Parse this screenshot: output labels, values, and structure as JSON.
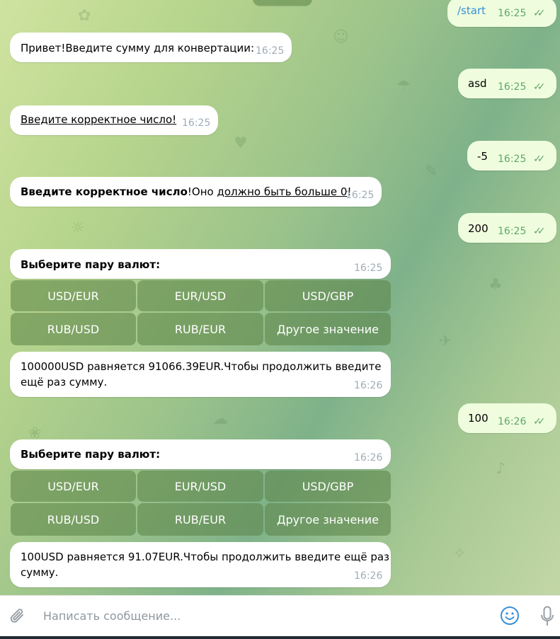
{
  "messages": [
    {
      "kind": "out",
      "text": "/start",
      "time": "16:25"
    },
    {
      "kind": "in",
      "text": "Привет!Введите сумму для конвертации:",
      "time": "16:25"
    },
    {
      "kind": "out",
      "text": "asd",
      "time": "16:25"
    },
    {
      "kind": "in",
      "text": "Введите корректное число!",
      "time": "16:25"
    },
    {
      "kind": "out",
      "text": "-5",
      "time": "16:25"
    },
    {
      "kind": "in",
      "bold": "Введите корректное число",
      "mid": "!Оно ",
      "link": "должно быть больше 0",
      "tail": "!",
      "time": "16:25"
    },
    {
      "kind": "out",
      "text": "200",
      "time": "16:25"
    },
    {
      "kind": "in",
      "text": "Выберите пару валют:",
      "time": "16:25"
    },
    {
      "kind": "in",
      "line1": "100000USD равняется 91066.39EUR.Чтобы продолжить введите",
      "line2": "ещё раз сумму.",
      "time": "16:26"
    },
    {
      "kind": "out",
      "text": "100",
      "time": "16:26"
    },
    {
      "kind": "in",
      "text": "Выберите пару валют:",
      "time": "16:26"
    },
    {
      "kind": "in",
      "line1": "100USD равняется 91.07EUR.Чтобы продолжить введите ещё раз",
      "line2": "сумму.",
      "time": "16:26"
    }
  ],
  "keyboard1": [
    "USD/EUR",
    "EUR/USD",
    "USD/GBP",
    "RUB/USD",
    "RUB/EUR",
    "Другое значение"
  ],
  "keyboard2": [
    "USD/EUR",
    "EUR/USD",
    "USD/GBP",
    "RUB/USD",
    "RUB/EUR",
    "Другое значение"
  ],
  "composer": {
    "placeholder": "Написать сообщение..."
  },
  "icons": {
    "attach": "paperclip-icon",
    "emoji": "smile-icon",
    "voice": "microphone-icon",
    "read": "double-check-icon"
  },
  "colors": {
    "incoming": "#ffffff",
    "outgoing": "#effdde",
    "accent": "#5fa86a",
    "keyboard": "#6f9a5c"
  }
}
